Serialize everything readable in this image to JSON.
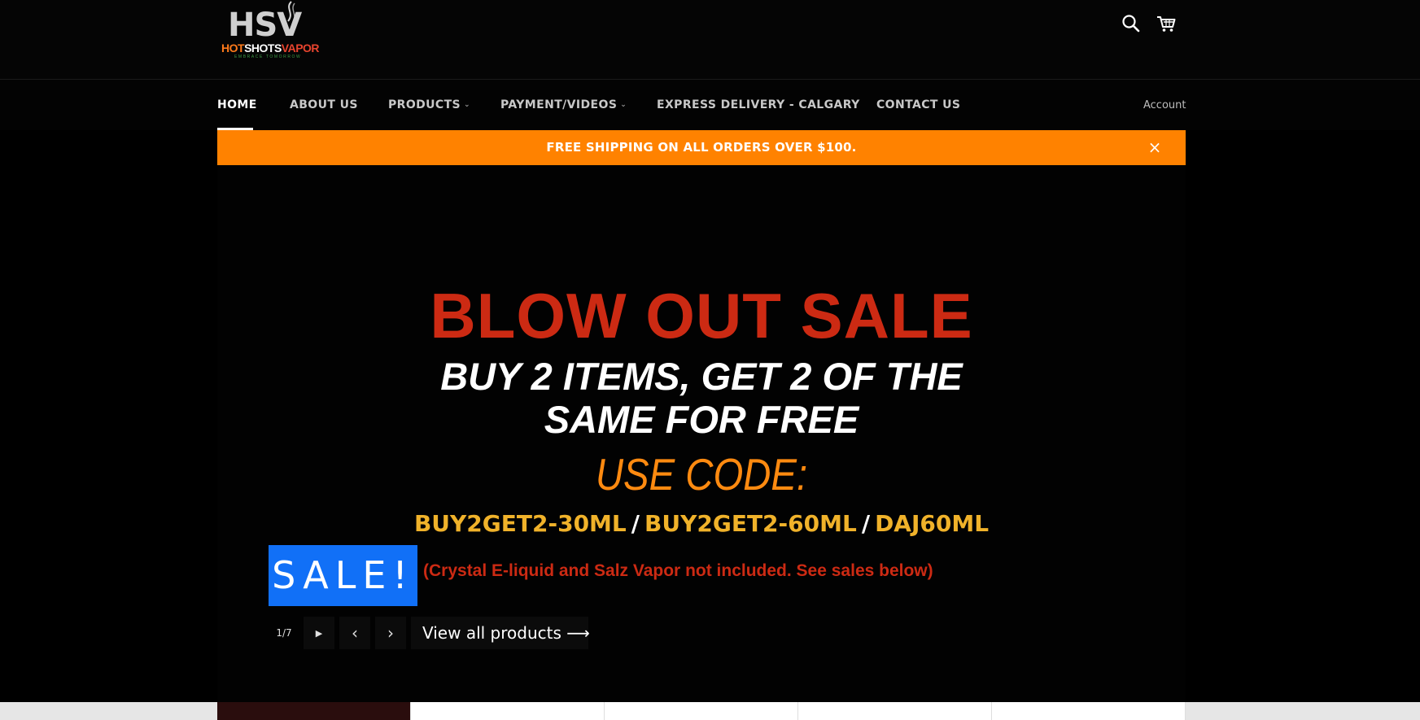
{
  "header": {
    "logo": {
      "mark": "HSV",
      "brand_hot": "HOT",
      "brand_shots": "SHOTS",
      "brand_vapor": "VAPOR",
      "tagline": "EMBRACE TOMORROW"
    },
    "icons": [
      "search-icon",
      "cart-icon"
    ]
  },
  "nav": {
    "items": [
      {
        "label": "HOME",
        "active": true
      },
      {
        "label": "ABOUT US"
      },
      {
        "label": "PRODUCTS",
        "dropdown": true
      },
      {
        "label": "PAYMENT/VIDEOS",
        "dropdown": true
      },
      {
        "label": "EXPRESS DELIVERY - CALGARY"
      },
      {
        "label": "CONTACT US"
      }
    ],
    "account_label": "Account"
  },
  "announcement": {
    "text": "FREE SHIPPING ON ALL ORDERS OVER $100.",
    "close_glyph": "×",
    "color": "#ff8200"
  },
  "hero": {
    "headline": "BLOW OUT SALE",
    "offer_line1": "BUY 2 ITEMS, GET 2 OF THE",
    "offer_line2": "SAME FOR FREE",
    "use_code": "USE CODE:",
    "codes": [
      "BUY2GET2-30ML",
      "BUY2GET2-60ML",
      "DAJ60ML"
    ],
    "code_separator": "/",
    "badge": "SALE!",
    "exclusion": "(Crystal E-liquid and Salz Vapor not included. See sales below)",
    "colors": {
      "headline": "#cc2a13",
      "use_code": "#ff8a10",
      "codes": "#f0b22a",
      "badge": "#1170f7"
    }
  },
  "slider": {
    "counter": "1/7",
    "play_glyph": "▶",
    "prev_glyph": "‹",
    "next_glyph": "›",
    "view_all": "View all products ⟶"
  }
}
